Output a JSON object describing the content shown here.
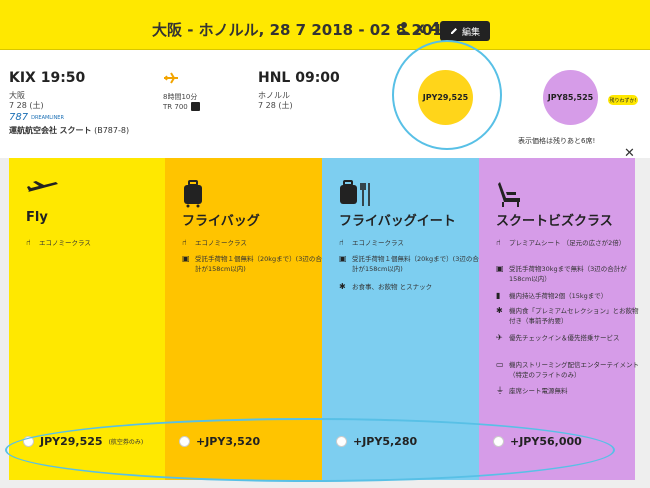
{
  "header": {
    "route": "大阪 - ホノルル, 28 7 2018 - 02 8 2018",
    "passengers": "x 4",
    "edit_label": "編集"
  },
  "flight": {
    "dep_time": "KIX 19:50",
    "dep_city": "大阪",
    "dep_date": "7 28 (土)",
    "aircraft_num": "787",
    "aircraft_logo": "DREAMLINER",
    "carrier_prefix": "運航航空会社",
    "carrier_name": "スクート",
    "aircraft_code": "(B787-8)",
    "duration": "8時間10分",
    "flight_no": "TR 700",
    "arr_time": "HNL 09:00",
    "arr_city": "ホノルル",
    "arr_date": "7 28 (土)"
  },
  "prices": {
    "fare1": "JPY29,525",
    "fare2": "JPY85,525",
    "remain_badge": "残りわずか!",
    "remain_text": "表示価格は残りあと6席!"
  },
  "fares": [
    {
      "title": "Fly",
      "features": [
        "エコノミークラス"
      ],
      "price": "JPY29,525",
      "note": "(航空券のみ)"
    },
    {
      "title": "フライバッグ",
      "features": [
        "エコノミークラス",
        "受託手荷物１個無料（20kgまで）(3辺の合計が158cm以内)"
      ],
      "price": "+JPY3,520"
    },
    {
      "title": "フライバッグイート",
      "features": [
        "エコノミークラス",
        "受託手荷物１個無料（20kgまで）(3辺の合計が158cm以内)",
        "お食事、お飲物 とスナック"
      ],
      "price": "+JPY5,280"
    },
    {
      "title": "スクートビズクラス",
      "features": [
        "プレミアムシート （足元の広さが2倍）",
        "受託手荷物30kgまで無料（3辺の合計が158cm以内）",
        "機内持込手荷物2個（15kgまで）",
        "機内食「プレミアムセレクション」とお飲物付き（事前予約要）",
        "優先チェックイン＆優先搭乗サービス",
        "機内ストリーミング配信エンターテイメント（特定のフライトのみ）",
        "座席シート電源無料"
      ],
      "price": "+JPY56,000"
    }
  ],
  "colors": {
    "brand_yellow": "#ffe800",
    "orange": "#ffc400",
    "blue": "#7dcef0",
    "purple": "#d69ce8",
    "highlight": "#58c0e6"
  },
  "icons": {
    "close": "close-icon",
    "user": "user-icon",
    "edit": "pencil-icon",
    "plane": "airplane-icon",
    "bag": "suitcase-icon",
    "food": "meal-icon",
    "seat": "seat-icon"
  }
}
